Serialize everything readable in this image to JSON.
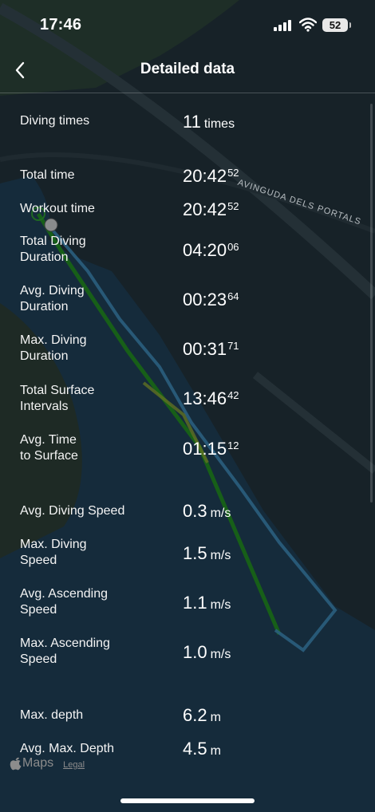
{
  "status_bar": {
    "time": "17:46",
    "battery": "52"
  },
  "header": {
    "title": "Detailed data"
  },
  "map": {
    "road_label": "AVINGUDA DELS PORTALS",
    "attribution": "Maps",
    "legal": "Legal"
  },
  "stats": [
    {
      "label": "Diving times",
      "main": "11",
      "sup": "",
      "unit": "times"
    },
    {
      "label": "Total time",
      "main": "20:42",
      "sup": "52",
      "unit": ""
    },
    {
      "label": "Workout time",
      "main": "20:42",
      "sup": "52",
      "unit": ""
    },
    {
      "label": "Total Diving\nDuration",
      "main": "04:20",
      "sup": "06",
      "unit": ""
    },
    {
      "label": "Avg. Diving\nDuration",
      "main": "00:23",
      "sup": "64",
      "unit": ""
    },
    {
      "label": "Max. Diving\nDuration",
      "main": "00:31",
      "sup": "71",
      "unit": ""
    },
    {
      "label": "Total Surface\nIntervals",
      "main": "13:46",
      "sup": "42",
      "unit": ""
    },
    {
      "label": "Avg. Time\nto Surface",
      "main": "01:15",
      "sup": "12",
      "unit": ""
    },
    {
      "label": "Avg. Diving Speed",
      "main": "0.3",
      "sup": "",
      "unit": "m/s"
    },
    {
      "label": "Max. Diving\nSpeed",
      "main": "1.5",
      "sup": "",
      "unit": "m/s"
    },
    {
      "label": "Avg. Ascending\nSpeed",
      "main": "1.1",
      "sup": "",
      "unit": "m/s"
    },
    {
      "label": "Max. Ascending\nSpeed",
      "main": "1.0",
      "sup": "",
      "unit": "m/s"
    },
    {
      "label": "Max. depth",
      "main": "6.2",
      "sup": "",
      "unit": "m"
    },
    {
      "label": "Avg. Max. Depth",
      "main": "4.5",
      "sup": "",
      "unit": "m"
    }
  ],
  "colors": {
    "track_green": "#1f8a1c",
    "track_blue": "#3d8ab8",
    "water": "#1d3d55",
    "land": "#27343b"
  }
}
